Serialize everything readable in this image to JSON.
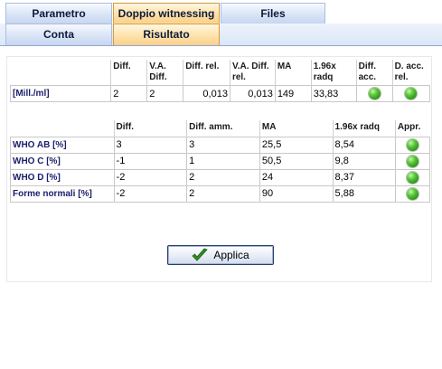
{
  "tabs_top": [
    {
      "label": "Parametro",
      "active": false
    },
    {
      "label": "Doppio witnessing",
      "active": true
    },
    {
      "label": "Files",
      "active": false
    }
  ],
  "tabs_sub": [
    {
      "label": "Conta",
      "active": false
    },
    {
      "label": "Risultato",
      "active": true
    }
  ],
  "table1": {
    "headers": [
      "Diff.",
      "V.A. Diff.",
      "Diff. rel.",
      "V.A. Diff. rel.",
      "MA",
      "1.96x radq",
      "Diff. acc.",
      "D. acc. rel."
    ],
    "rows": [
      {
        "label": "[Mill./ml]",
        "values": [
          "2",
          "2",
          "0,013",
          "0,013",
          "149",
          "33,83"
        ],
        "status": [
          "ok",
          "ok"
        ]
      }
    ]
  },
  "table2": {
    "headers": [
      "Diff.",
      "Diff. amm.",
      "MA",
      "1.96x radq",
      "Appr."
    ],
    "rows": [
      {
        "label": "WHO AB [%]",
        "values": [
          "3",
          "3",
          "25,5",
          "8,54"
        ],
        "status": "ok"
      },
      {
        "label": "WHO C [%]",
        "values": [
          "-1",
          "1",
          "50,5",
          "9,8"
        ],
        "status": "ok"
      },
      {
        "label": "WHO D [%]",
        "values": [
          "-2",
          "2",
          "24",
          "8,37"
        ],
        "status": "ok"
      },
      {
        "label": "Forme normali [%]",
        "values": [
          "-2",
          "2",
          "90",
          "5,88"
        ],
        "status": "ok"
      }
    ]
  },
  "apply_button": {
    "label": "Applica",
    "icon": "checkmark-icon"
  },
  "colors": {
    "status_ok": "#3fae24",
    "active_tab": "#fde0a6",
    "tab": "#d9e4f6",
    "label_text": "#1b1e6b"
  }
}
